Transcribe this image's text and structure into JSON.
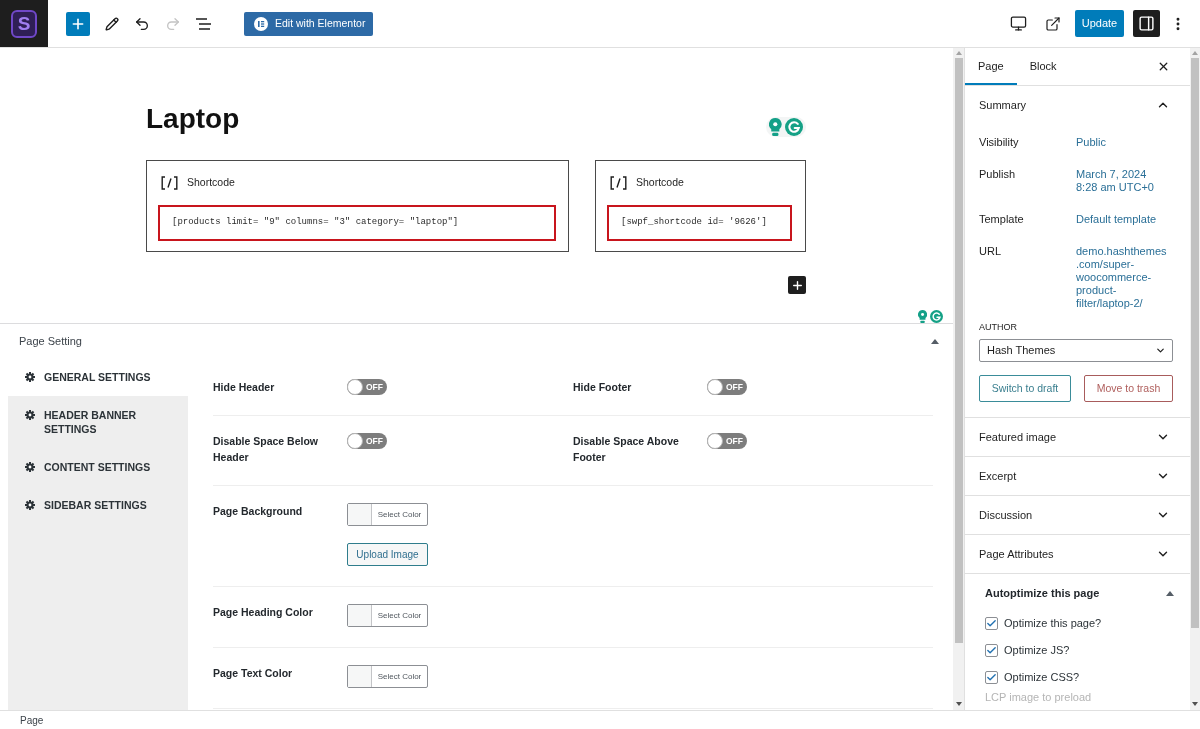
{
  "top_bar": {
    "logo_letter": "S",
    "tools": [
      {
        "kind": "inserter",
        "disabled": false
      },
      {
        "kind": "tools",
        "disabled": false
      },
      {
        "kind": "undo",
        "disabled": false
      },
      {
        "kind": "redo",
        "disabled": true
      },
      {
        "kind": "list_view",
        "disabled": false
      }
    ],
    "elementor_button": "Edit with Elementor",
    "view_tools": [
      {
        "kind": "preview"
      },
      {
        "kind": "view_page"
      }
    ],
    "update_button": "Update",
    "settings_toggle": {
      "selected": true
    }
  },
  "editor": {
    "title": "Laptop",
    "blocks": [
      {
        "label": "Shortcode",
        "code": "[products limit= \"9\" columns= \"3\" category= \"laptop\"]",
        "highlighted": true
      },
      {
        "label": "Shortcode",
        "code": "[swpf_shortcode id= '9626']",
        "highlighted": true
      }
    ]
  },
  "page_setting": {
    "title": "Page Setting",
    "expanded": true,
    "nav": [
      {
        "label": "GENERAL SETTINGS",
        "selected": true
      },
      {
        "label": "HEADER BANNER SETTINGS",
        "selected": false
      },
      {
        "label": "CONTENT SETTINGS",
        "selected": false
      },
      {
        "label": "SIDEBAR SETTINGS",
        "selected": false
      }
    ],
    "rows": [
      {
        "fields": [
          {
            "kind": "toggle",
            "label": "Hide Header",
            "on": false,
            "switch_text": "OFF"
          },
          {
            "kind": "toggle",
            "label": "Hide Footer",
            "on": false,
            "switch_text": "OFF"
          }
        ]
      },
      {
        "fields": [
          {
            "kind": "toggle",
            "label": "Disable Space Below Header",
            "on": false,
            "switch_text": "OFF"
          },
          {
            "kind": "toggle",
            "label": "Disable Space Above Footer",
            "on": false,
            "switch_text": "OFF"
          }
        ]
      },
      {
        "fields": [
          {
            "kind": "color",
            "label": "Page Background",
            "button": "Select Color",
            "upload_button": "Upload Image"
          }
        ]
      },
      {
        "fields": [
          {
            "kind": "color",
            "label": "Page Heading Color",
            "button": "Select Color"
          }
        ]
      },
      {
        "fields": [
          {
            "kind": "color",
            "label": "Page Text Color",
            "button": "Select Color"
          }
        ]
      }
    ]
  },
  "sidebar": {
    "tabs": [
      {
        "label": "Page",
        "selected": true
      },
      {
        "label": "Block",
        "selected": false
      }
    ],
    "summary": {
      "title": "Summary",
      "expanded": true,
      "rows": [
        {
          "label": "Visibility",
          "value": "Public"
        },
        {
          "label": "Publish",
          "value": "March 7, 2024 8:28 am UTC+0"
        },
        {
          "label": "Template",
          "value": "Default template"
        },
        {
          "label": "URL",
          "value": "demo.hashthemes.com/super-woocommerce-product-filter/laptop-2/"
        }
      ],
      "author": {
        "label": "AUTHOR",
        "value": "Hash Themes"
      },
      "buttons": [
        {
          "kind": "draft",
          "label": "Switch to draft"
        },
        {
          "kind": "trash",
          "label": "Move to trash"
        }
      ]
    },
    "panels": [
      {
        "title": "Featured image",
        "expanded": false
      },
      {
        "title": "Excerpt",
        "expanded": false
      },
      {
        "title": "Discussion",
        "expanded": false
      },
      {
        "title": "Page Attributes",
        "expanded": false
      }
    ],
    "autoptimize": {
      "title": "Autoptimize this page",
      "expanded": true,
      "options": [
        {
          "label": "Optimize this page?",
          "checked": true
        },
        {
          "label": "Optimize JS?",
          "checked": true
        },
        {
          "label": "Optimize CSS?",
          "checked": true
        }
      ],
      "next_label": "LCP image to preload"
    }
  },
  "status_bar": {
    "breadcrumb": "Page"
  }
}
